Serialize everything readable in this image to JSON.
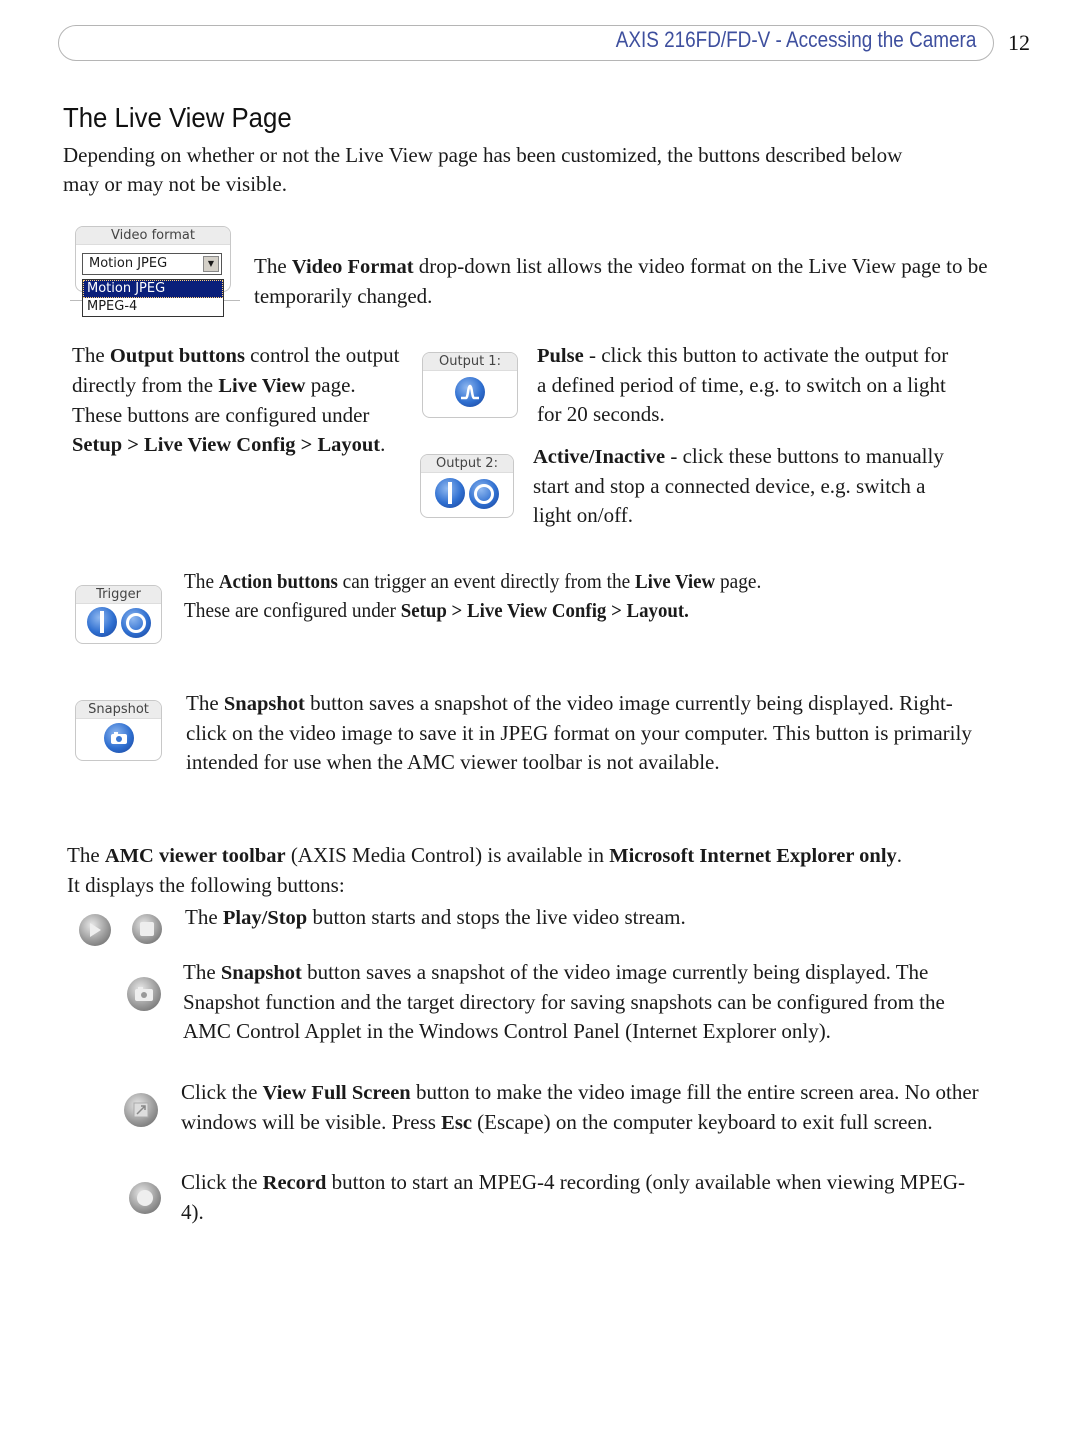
{
  "header": {
    "title": "AXIS 216FD/FD-V - Accessing the Camera",
    "page_number": "12"
  },
  "page_title": "The Live View Page",
  "intro": "Depending on whether or not the Live View page has been customized, the buttons described below may or may not be visible.",
  "video_format": {
    "widget_label": "Video format",
    "selected": "Motion JPEG",
    "options": [
      "Motion JPEG",
      "MPEG-4"
    ],
    "text_1": "The ",
    "bold_1": "Video Format",
    "text_2": " drop-down list allows the video format on the Live View page to be temporarily changed."
  },
  "output_buttons": {
    "t1": "The ",
    "b1": "Output buttons",
    "t2": " control the output directly from the ",
    "b2": "Live View",
    "t3": " page. These buttons are configured under ",
    "b3": "Setup > Live View Config > Layout",
    "t4": "."
  },
  "output1": {
    "widget_label": "Output 1:",
    "bold": "Pulse",
    "text": " - click this button to activate the output for a defined period of time, e.g. to switch on a light for 20 seconds."
  },
  "output2": {
    "widget_label": "Output 2:",
    "bold": "Active/Inactive",
    "text": " - click these buttons to manually start and stop a connected device, e.g. switch a light on/off."
  },
  "trigger": {
    "widget_label": "Trigger",
    "line1_t1": "The ",
    "line1_b1": "Action buttons",
    "line1_t2": " can trigger an event directly from the ",
    "line1_b2": "Live View",
    "line1_t3": " page.",
    "line2_t1": "These are configured under ",
    "line2_b1": "Setup > Live View Config > Layout."
  },
  "snapshot": {
    "widget_label": "Snapshot",
    "t1": "The ",
    "b1": "Snapshot",
    "t2": " button saves a snapshot of the video image currently being displayed. Right-click on the video image to save it in JPEG format on your computer. This button is primarily intended for use when the AMC viewer toolbar is not available."
  },
  "amc": {
    "t1": "The ",
    "b1": "AMC viewer toolbar",
    "t2": " (AXIS Media Control) is available in ",
    "b2": "Microsoft Internet Explorer only",
    "t3": ". It displays the following buttons:",
    "playstop": {
      "t1": "The ",
      "b1": "Play/Stop",
      "t2": " button starts and stops the live video stream."
    },
    "snapshot": {
      "t1": "The ",
      "b1": "Snapshot",
      "t2": " button saves a snapshot of the video image currently being displayed. The Snapshot function and the target directory for saving snapshots can be configured from the AMC Control Applet in the Windows Control Panel (Internet Explorer only)."
    },
    "fullscreen": {
      "t1": "Click the ",
      "b1": "View Full Screen",
      "t2": " button to make the video image fill the entire screen area. No other windows will be visible. Press ",
      "b2": "Esc",
      "t3": " (Escape) on the computer keyboard to exit full screen."
    },
    "record": {
      "t1": "Click the ",
      "b1": "Record",
      "t2": " button to start an MPEG-4 recording (only available when viewing MPEG-4)."
    }
  }
}
